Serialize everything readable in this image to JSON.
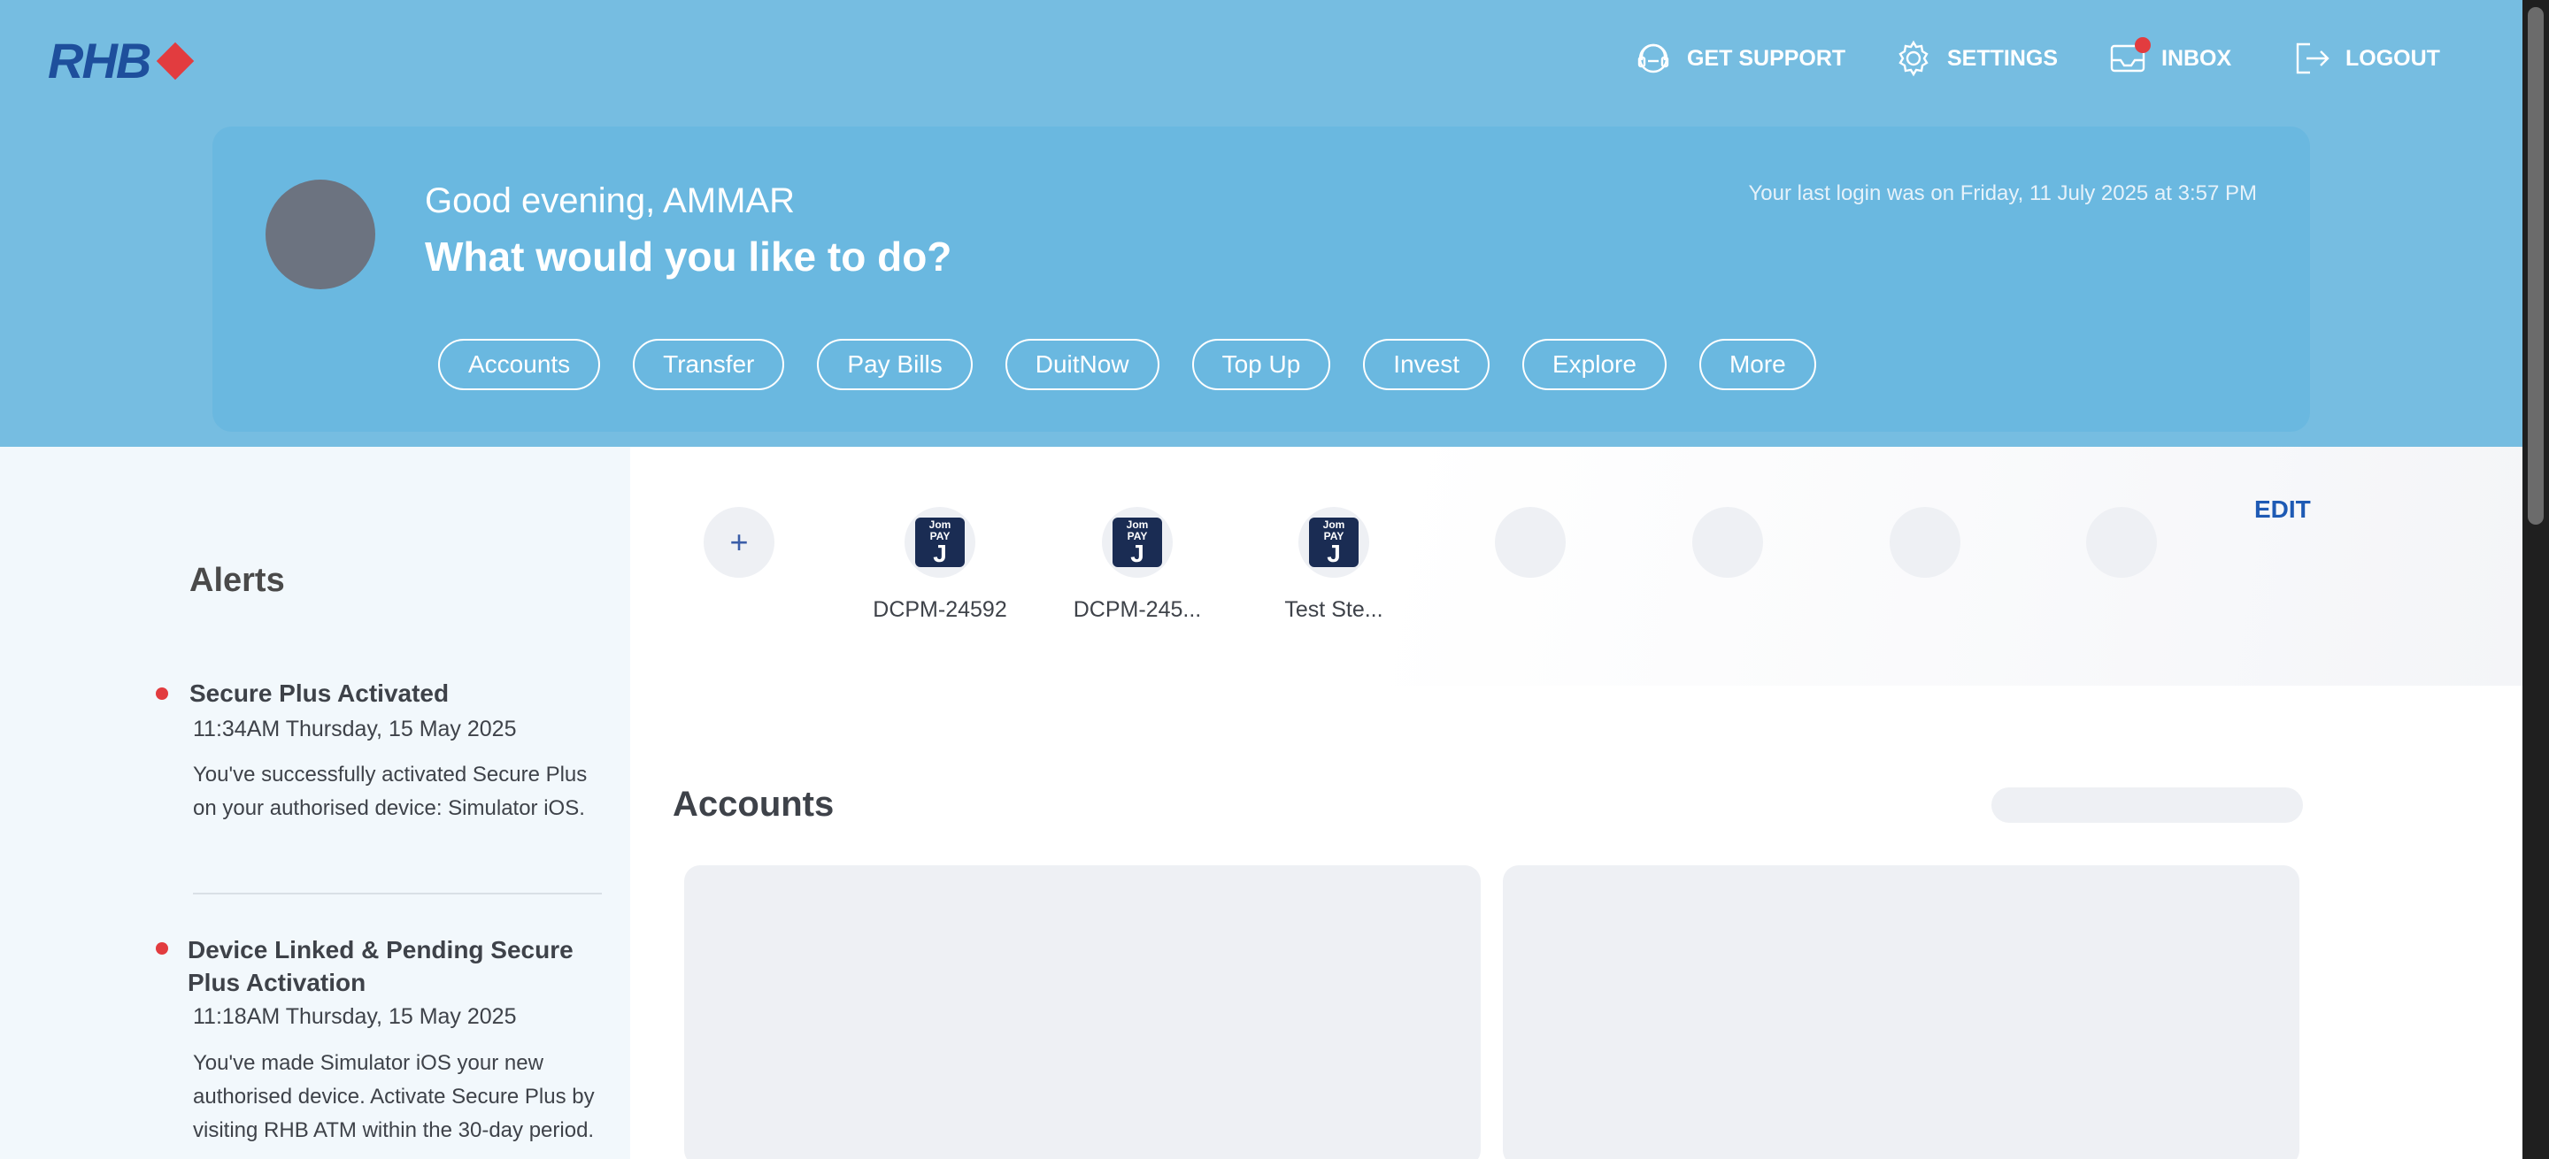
{
  "brand": {
    "logo_text": "RHB"
  },
  "nav": {
    "support": "GET SUPPORT",
    "settings": "SETTINGS",
    "inbox": "INBOX",
    "logout": "LOGOUT"
  },
  "greeting": {
    "hello": "Good evening, AMMAR",
    "question": "What would you like to do?",
    "last_login": "Your last login was on Friday, 11 July 2025 at 3:57 PM"
  },
  "quick_actions": [
    "Accounts",
    "Transfer",
    "Pay Bills",
    "DuitNow",
    "Top Up",
    "Invest",
    "Explore",
    "More"
  ],
  "favourites": {
    "add_symbol": "+",
    "items": [
      {
        "label": "DCPM-24592",
        "icon": "jompay-icon",
        "logo_top": "Jom",
        "logo_mid": "PAY",
        "logo_j": "J"
      },
      {
        "label": "DCPM-245...",
        "icon": "jompay-icon",
        "logo_top": "Jom",
        "logo_mid": "PAY",
        "logo_j": "J"
      },
      {
        "label": "Test Ste...",
        "icon": "jompay-icon",
        "logo_top": "Jom",
        "logo_mid": "PAY",
        "logo_j": "J"
      }
    ],
    "edit_label": "EDIT"
  },
  "alerts": {
    "title": "Alerts",
    "items": [
      {
        "title": "Secure Plus Activated",
        "time": "11:34AM Thursday, 15 May 2025",
        "body": "You've successfully activated Secure Plus on your authorised device: Simulator iOS."
      },
      {
        "title": "Device Linked & Pending Secure Plus Activation",
        "time": "11:18AM Thursday, 15 May 2025",
        "body": "You've made Simulator iOS your new authorised device. Activate Secure Plus by visiting RHB ATM within the 30-day period."
      }
    ]
  },
  "accounts": {
    "title": "Accounts"
  },
  "colors": {
    "header_bg": "#76bde1",
    "brand_blue": "#1e4f9c",
    "brand_red": "#e23c3f"
  }
}
